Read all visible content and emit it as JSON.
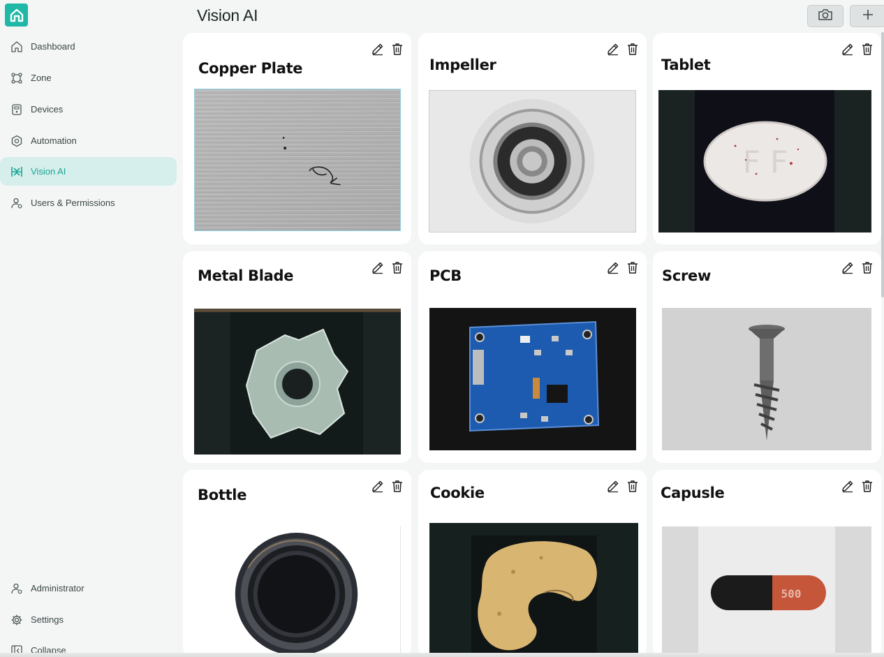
{
  "app": {
    "page_title": "Vision AI"
  },
  "sidebar": {
    "logo_icon": "home-logo-icon",
    "items": [
      {
        "label": "Dashboard",
        "icon": "home-icon"
      },
      {
        "label": "Zone",
        "icon": "zone-icon"
      },
      {
        "label": "Devices",
        "icon": "device-icon"
      },
      {
        "label": "Automation",
        "icon": "automation-icon"
      },
      {
        "label": "Vision AI",
        "icon": "vision-icon",
        "active": true
      },
      {
        "label": "Users & Permissions",
        "icon": "users-icon"
      }
    ],
    "bottom_items": [
      {
        "label": "Administrator",
        "icon": "admin-icon"
      },
      {
        "label": "Settings",
        "icon": "gear-icon"
      },
      {
        "label": "Collapse",
        "icon": "collapse-icon"
      }
    ]
  },
  "header": {
    "camera_button_icon": "camera-icon",
    "add_button_icon": "plus-icon"
  },
  "cards": [
    {
      "title": "Copper Plate"
    },
    {
      "title": "Impeller"
    },
    {
      "title": "Tablet"
    },
    {
      "title": "Metal Blade"
    },
    {
      "title": "PCB"
    },
    {
      "title": "Screw"
    },
    {
      "title": "Bottle"
    },
    {
      "title": "Cookie"
    },
    {
      "title": "Capusle"
    }
  ],
  "colors": {
    "accent": "#1fb8a6",
    "active_bg": "#d6efec",
    "background": "#f4f6f5",
    "card": "#ffffff"
  }
}
